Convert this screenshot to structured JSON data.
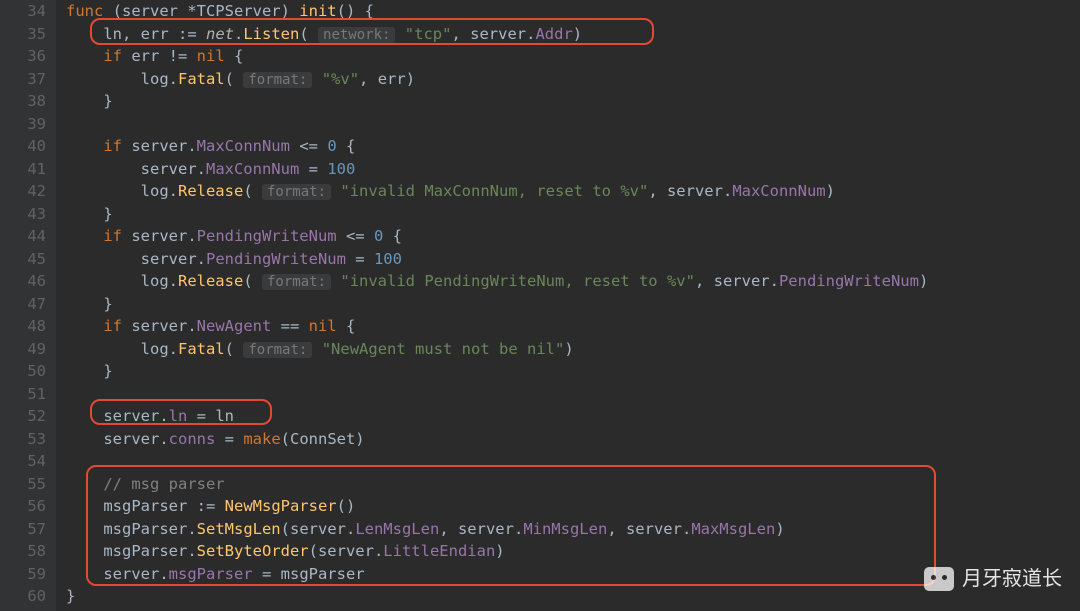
{
  "line_start": 34,
  "line_end": 60,
  "watermark": "月牙寂道长",
  "code": {
    "fn_decl_prefix": "func (server *TCPServer) ",
    "fn_name": "init",
    "fn_decl_suffix": "() {",
    "l35_a": "ln, err := ",
    "l35_pkg": "net",
    "l35_b": ".",
    "l35_fn": "Listen",
    "l35_c": "(",
    "l35_h": "network:",
    "l35_d": " ",
    "l35_s": "\"tcp\"",
    "l35_e": ", server.",
    "l35_f": "Addr",
    "l35_g": ")",
    "l36": "if err != nil {",
    "l37_a": "log.",
    "l37_fn": "Fatal",
    "l37_b": "(",
    "l37_h": "format:",
    "l37_c": " ",
    "l37_s": "\"%v\"",
    "l37_d": ", err)",
    "l38": "}",
    "l40_a": "if ",
    "l40_b": "server.",
    "l40_f": "MaxConnNum",
    "l40_c": " <= ",
    "l40_n": "0",
    "l40_d": " {",
    "l41_a": "server.",
    "l41_f": "MaxConnNum",
    "l41_b": " = ",
    "l41_n": "100",
    "l42_a": "log.",
    "l42_fn": "Release",
    "l42_b": "(",
    "l42_h": "format:",
    "l42_c": " ",
    "l42_s": "\"invalid MaxConnNum, reset to %v\"",
    "l42_d": ", server.",
    "l42_f": "MaxConnNum",
    "l42_e": ")",
    "l43": "}",
    "l44_a": "if ",
    "l44_b": "server.",
    "l44_f": "PendingWriteNum",
    "l44_c": " <= ",
    "l44_n": "0",
    "l44_d": " {",
    "l45_a": "server.",
    "l45_f": "PendingWriteNum",
    "l45_b": " = ",
    "l45_n": "100",
    "l46_a": "log.",
    "l46_fn": "Release",
    "l46_b": "(",
    "l46_h": "format:",
    "l46_c": " ",
    "l46_s": "\"invalid PendingWriteNum, reset to %v\"",
    "l46_d": ", server.",
    "l46_f": "PendingWriteNum",
    "l46_e": ")",
    "l47": "}",
    "l48_a": "if ",
    "l48_b": "server.",
    "l48_f": "NewAgent",
    "l48_c": " == ",
    "l48_n": "nil",
    "l48_d": " {",
    "l49_a": "log.",
    "l49_fn": "Fatal",
    "l49_b": "(",
    "l49_h": "format:",
    "l49_c": " ",
    "l49_s": "\"NewAgent must not be nil\"",
    "l49_d": ")",
    "l50": "}",
    "l52_a": "server.",
    "l52_f": "ln",
    "l52_b": " = ln",
    "l53_a": "server.",
    "l53_f": "conns",
    "l53_b": " = ",
    "l53_fn": "make",
    "l53_c": "(ConnSet)",
    "l55": "// msg parser",
    "l56_a": "msgParser := ",
    "l56_fn": "NewMsgParser",
    "l56_b": "()",
    "l57_a": "msgParser.",
    "l57_fn": "SetMsgLen",
    "l57_b": "(server.",
    "l57_f1": "LenMsgLen",
    "l57_c": ", server.",
    "l57_f2": "MinMsgLen",
    "l57_d": ", server.",
    "l57_f3": "MaxMsgLen",
    "l57_e": ")",
    "l58_a": "msgParser.",
    "l58_fn": "SetByteOrder",
    "l58_b": "(server.",
    "l58_f": "LittleEndian",
    "l58_c": ")",
    "l59_a": "server.",
    "l59_f": "msgParser",
    "l59_b": " = msgParser",
    "l60": "}"
  }
}
